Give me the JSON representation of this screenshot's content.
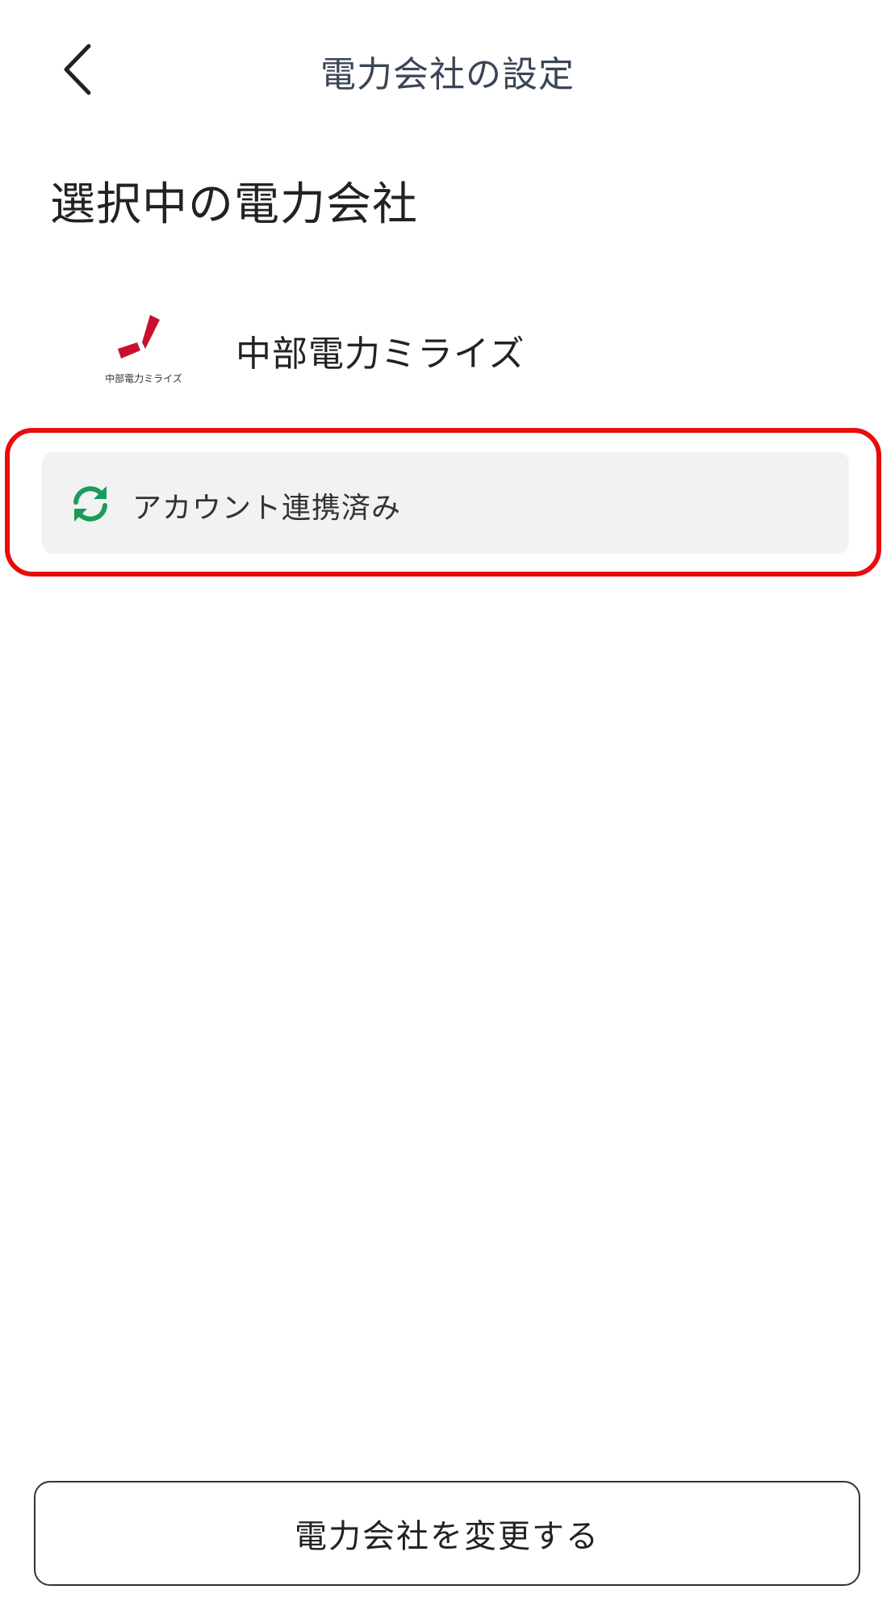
{
  "header": {
    "title": "電力会社の設定",
    "back_icon": "chevron-left-icon"
  },
  "section": {
    "title": "選択中の電力会社"
  },
  "provider": {
    "name": "中部電力ミライズ",
    "logo_text": "中部電力ミライズ",
    "logo_color": "#c8102e"
  },
  "status": {
    "label": "アカウント連携済み",
    "icon": "sync-icon",
    "icon_color": "#1a9c5b"
  },
  "highlight": {
    "color": "#e80d0d"
  },
  "footer": {
    "change_button_label": "電力会社を変更する"
  }
}
